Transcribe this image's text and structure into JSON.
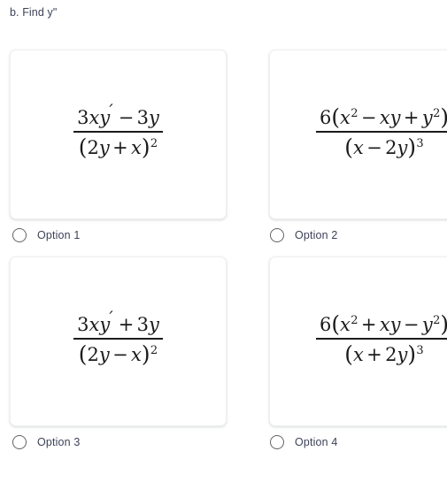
{
  "question": {
    "text": "b. Find y\""
  },
  "options": [
    {
      "id": "option-1",
      "label": "Option 1",
      "selected": false,
      "formula_text": "(3xy' - 3y) / (2y + x)^2",
      "numerator": {
        "coefficient": "3",
        "var_x": "x",
        "var_y": "y",
        "prime": "′",
        "operator": "−",
        "term2_coefficient": "3",
        "term2_var": "y"
      },
      "denominator": {
        "open_paren": "(",
        "coefficient": "2",
        "var_y": "y",
        "operator": "+",
        "var_x": "x",
        "close_paren": ")",
        "exponent": "2"
      }
    },
    {
      "id": "option-2",
      "label": "Option 2",
      "selected": false,
      "formula_text": "6(x^2 - xy + y^2) / (x - 2y)^3",
      "numerator": {
        "coefficient": "6",
        "open_paren": "(",
        "t1_var": "x",
        "t1_exp": "2",
        "op1": "−",
        "t2_var1": "x",
        "t2_var2": "y",
        "op2": "+",
        "t3_var": "y",
        "t3_exp": "2",
        "close_paren": ")"
      },
      "denominator": {
        "open_paren": "(",
        "var_x": "x",
        "operator": "−",
        "coefficient": "2",
        "var_y": "y",
        "close_paren": ")",
        "exponent": "3"
      }
    },
    {
      "id": "option-3",
      "label": "Option 3",
      "selected": false,
      "formula_text": "(3xy' + 3y) / (2y - x)^2",
      "numerator": {
        "coefficient": "3",
        "var_x": "x",
        "var_y": "y",
        "prime": "′",
        "operator": "+",
        "term2_coefficient": "3",
        "term2_var": "y"
      },
      "denominator": {
        "open_paren": "(",
        "coefficient": "2",
        "var_y": "y",
        "operator": "−",
        "var_x": "x",
        "close_paren": ")",
        "exponent": "2"
      }
    },
    {
      "id": "option-4",
      "label": "Option 4",
      "selected": false,
      "formula_text": "6(x^2 + xy - y^2) / (x + 2y)^3",
      "numerator": {
        "coefficient": "6",
        "open_paren": "(",
        "t1_var": "x",
        "t1_exp": "2",
        "op1": "+",
        "t2_var1": "x",
        "t2_var2": "y",
        "op2": "−",
        "t3_var": "y",
        "t3_exp": "2",
        "close_paren": ")"
      },
      "denominator": {
        "open_paren": "(",
        "var_x": "x",
        "operator": "+",
        "coefficient": "2",
        "var_y": "y",
        "close_paren": ")",
        "exponent": "3"
      }
    }
  ],
  "colors": {
    "text": "#3c4257",
    "math": "#1b1b1b",
    "card_border": "#eceff1",
    "radio_border": "#5f6368",
    "background": "#ffffff"
  }
}
